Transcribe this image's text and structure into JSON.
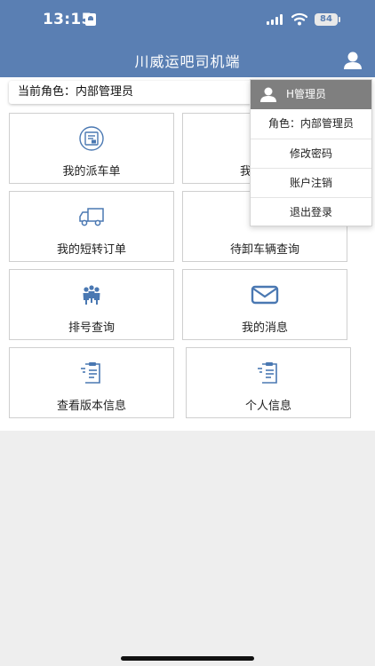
{
  "status_bar": {
    "time": "13:15",
    "battery": "84"
  },
  "header": {
    "title": "川威运吧司机端"
  },
  "role_bar": {
    "text": "当前角色：内部管理员"
  },
  "tiles": [
    {
      "label": "我的派车单",
      "icon": "dispatch-doc-icon"
    },
    {
      "label": "我",
      "icon": "partial-hidden"
    },
    {
      "label": "我的短转订单",
      "icon": "truck-icon"
    },
    {
      "label": "待卸车辆查询",
      "icon": "truck-icon"
    },
    {
      "label": "排号查询",
      "icon": "people-queue-icon"
    },
    {
      "label": "我的消息",
      "icon": "mail-icon"
    },
    {
      "label": "查看版本信息",
      "icon": "clipboard-icon"
    },
    {
      "label": "个人信息",
      "icon": "clipboard-icon"
    }
  ],
  "dropdown": {
    "user_name": "H管理员",
    "role": "角色：内部管理员",
    "items": [
      "修改密码",
      "账户注销",
      "退出登录"
    ]
  },
  "colors": {
    "header": "#5a7fb3",
    "icon": "#4a78b2",
    "dropdown_head": "#7f7f7f"
  }
}
